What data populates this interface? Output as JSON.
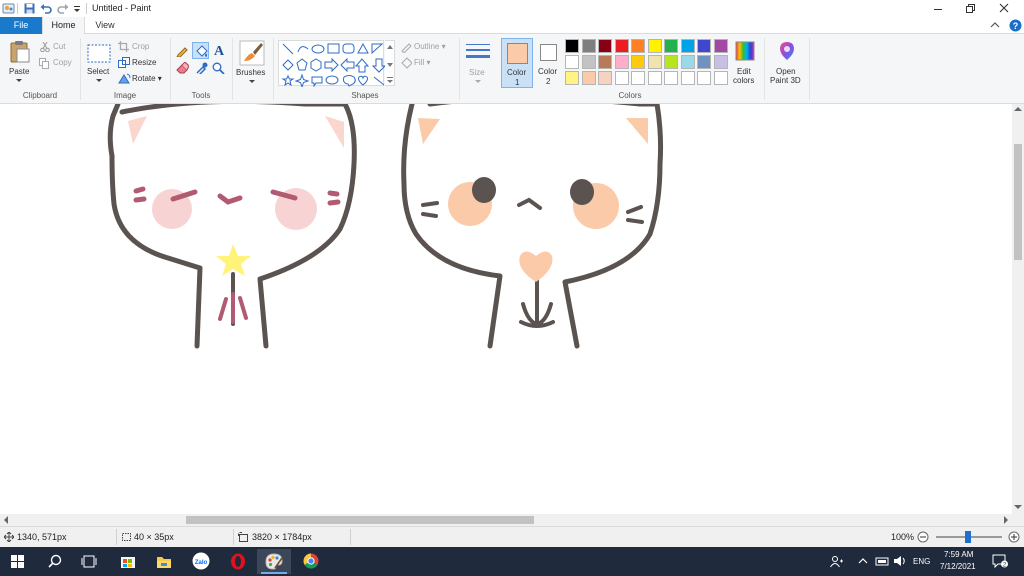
{
  "window": {
    "title": "Untitled - Paint"
  },
  "tabs": [
    {
      "label": "File"
    },
    {
      "label": "Home"
    },
    {
      "label": "View"
    }
  ],
  "ribbon": {
    "clipboard": {
      "paste": "Paste",
      "cut": "Cut",
      "copy": "Copy",
      "group": "Clipboard"
    },
    "image": {
      "select": "Select",
      "crop": "Crop",
      "resize": "Resize",
      "rotate": "Rotate",
      "group": "Image"
    },
    "tools": {
      "group": "Tools"
    },
    "brushes": {
      "label": "Brushes"
    },
    "shapes": {
      "outline": "Outline",
      "fill": "Fill",
      "group": "Shapes"
    },
    "size": {
      "label": "Size"
    },
    "color1": {
      "label": "Color",
      "num": "1",
      "color": "#fbcaa8"
    },
    "color2": {
      "label": "Color",
      "num": "2",
      "color": "#ffffff"
    },
    "colors": {
      "group": "Colors",
      "row1": [
        "#000000",
        "#7f7f7f",
        "#880015",
        "#ed1c24",
        "#ff7f27",
        "#fff200",
        "#22b14c",
        "#00a2e8",
        "#3f48cc",
        "#a349a4"
      ],
      "row2": [
        "#ffffff",
        "#c3c3c3",
        "#b97a57",
        "#ffaec9",
        "#ffc90e",
        "#efe4b0",
        "#b5e61d",
        "#99d9ea",
        "#7092be",
        "#c8bfe7"
      ],
      "row3": [
        "#fff384",
        "#fbcaa8",
        "#f6d2c0",
        "#ffffff",
        "#ffffff",
        "#ffffff",
        "#ffffff",
        "#ffffff",
        "#ffffff",
        "#ffffff"
      ]
    },
    "edit_colors": {
      "line1": "Edit",
      "line2": "colors"
    },
    "paint3d": {
      "line1": "Open",
      "line2": "Paint 3D"
    }
  },
  "status": {
    "cursor": "1340, 571px",
    "selection": "40 × 35px",
    "image_size": "3820 × 1784px",
    "zoom": "100%"
  },
  "taskbar": {
    "apps": [
      "windows-start",
      "search",
      "task-view",
      "store",
      "file-explorer",
      "zalo",
      "opera",
      "paint",
      "chrome"
    ],
    "zalo_label": "Zalo",
    "lang": "ENG",
    "time": "7:59 AM",
    "date": "7/12/2021",
    "notifications": "2"
  }
}
